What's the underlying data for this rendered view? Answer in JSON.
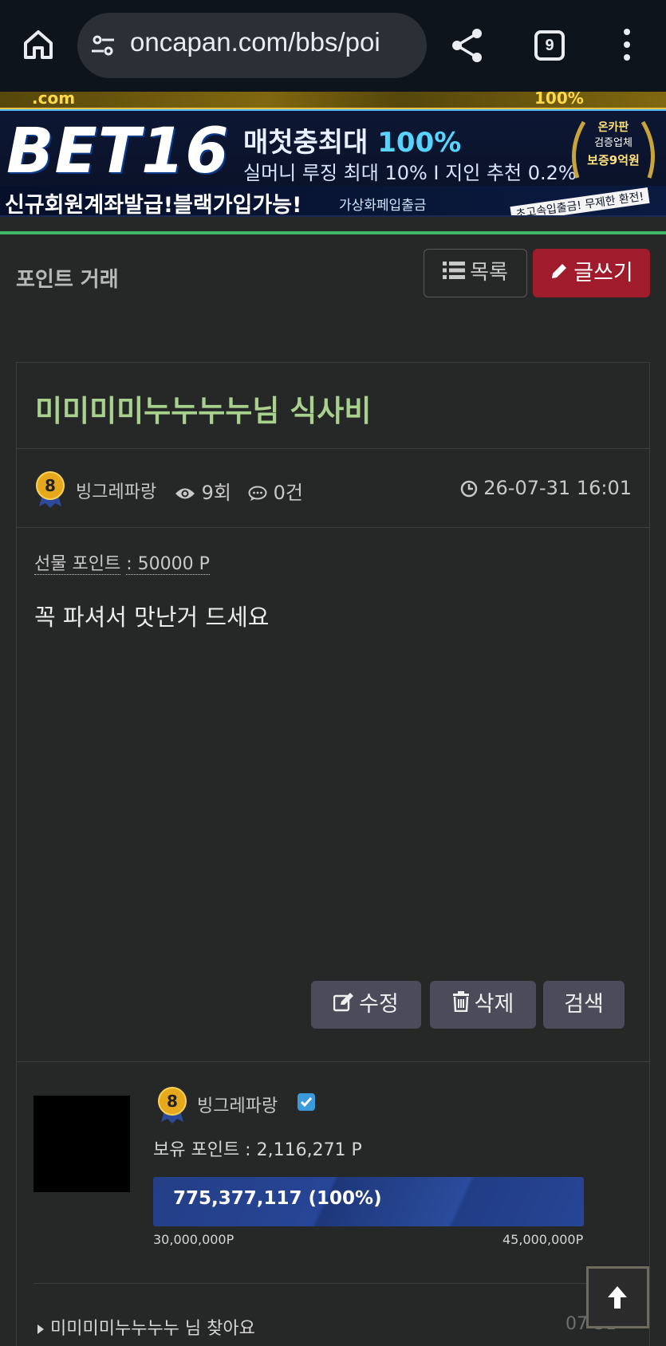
{
  "browser": {
    "url": "oncapan.com/bbs/poi",
    "tab_count": "9"
  },
  "banner": {
    "top_left": ".com",
    "top_right": "100%",
    "logo_text": "BET",
    "logo_num": "16",
    "headline_pre": "매첫충최대 ",
    "headline_pct": "100%",
    "subline": "실머니 루징 최대 10% I 지인 추천 0.2%",
    "bottom_text": "신규회원계좌발급!블랙가입가능!",
    "bottom_sub": "가상화페입출금",
    "bottom_tag": "초고속입출금! 무제한 환전!",
    "badge_line1": "온카판",
    "badge_line2": "검증업체",
    "badge_line3": "보증9억원"
  },
  "board": {
    "title": "포인트 거래",
    "list_label": "목록",
    "write_label": "글쓰기"
  },
  "post": {
    "title": "미미미미누누누누님 식사비",
    "author_level": "8",
    "author": "빙그레파랑",
    "views": "9회",
    "comments": "0건",
    "date": "26-07-31 16:01",
    "gift_label": "선물 포인트",
    "gift_value": ": 50000 P",
    "body": "꼭 파셔서 맛난거 드세요",
    "edit_label": "수정",
    "delete_label": "삭제",
    "search_label": "검색"
  },
  "profile": {
    "level": "8",
    "name": "빙그레파랑",
    "points": "보유 포인트 : 2,116,271 P",
    "progress_text": "775,377,117 (100%)",
    "progress_fraction": 1.0,
    "progress_min": "30,000,000P",
    "progress_max": "45,000,000P",
    "recent_item": "미미미미누누누누 님 찾아요",
    "recent_date": "07-31"
  }
}
